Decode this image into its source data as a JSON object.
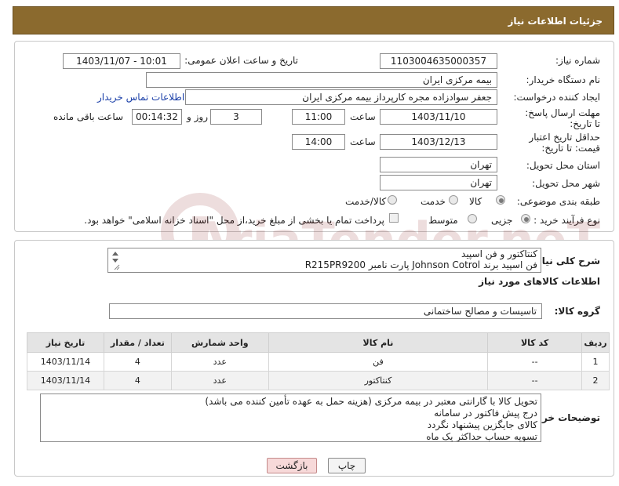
{
  "header": {
    "title": "جزئیات اطلاعات نیاز"
  },
  "form": {
    "need_number_label": "شماره نیاز:",
    "need_number": "1103004635000357",
    "announce_label": "تاریخ و ساعت اعلان عمومی:",
    "announce_value": "1403/11/07 - 10:01",
    "buyer_org_label": "نام دستگاه خریدار:",
    "buyer_org": "بیمه مرکزی ایران",
    "creator_label": "ایجاد کننده درخواست:",
    "creator": "جعفر سوادزاده مجره کارپرداز بیمه مرکزی ایران",
    "contact_link": "اطلاعات تماس خریدار",
    "deadline_label": "مهلت ارسال پاسخ: تا تاریخ:",
    "deadline_date": "1403/11/10",
    "time_label": "ساعت",
    "deadline_time": "11:00",
    "days_value": "3",
    "days_label": "روز و",
    "remaining_value": "00:14:32",
    "remaining_label": "ساعت باقی مانده",
    "validity_label": "حداقل تاریخ اعتبار قیمت: تا تاریخ:",
    "validity_date": "1403/12/13",
    "validity_time_label": "ساعت",
    "validity_time": "14:00",
    "province_label": "استان محل تحویل:",
    "province": "تهران",
    "city_label": "شهر محل تحویل:",
    "city": "تهران",
    "category_label": "طبقه بندی موضوعی:",
    "category_options": [
      "کالا",
      "خدمت",
      "کالا/خدمت"
    ],
    "process_label": "نوع فرآیند خرید :",
    "process_options": [
      "جزیی",
      "متوسط"
    ],
    "payment_note": "پرداخت تمام یا بخشی از مبلغ خرید،از محل \"اسناد خزانه اسلامی\" خواهد بود."
  },
  "summary": {
    "label": "شرح کلی نیاز:",
    "line1": "کنتاکتور و فن اسپید",
    "line2": "فن اسپید برند Johnson Cotrol پارت نامبر R215PR9200"
  },
  "goods": {
    "section_title": "اطلاعات کالاهای مورد نیاز",
    "group_label": "گروه کالا:",
    "group_value": "تاسیسات و مصالح ساختمانی",
    "table": {
      "headers": [
        "ردیف",
        "کد کالا",
        "نام کالا",
        "واحد شمارش",
        "تعداد / مقدار",
        "تاریخ نیاز"
      ],
      "rows": [
        [
          "1",
          "--",
          "فن",
          "عدد",
          "4",
          "1403/11/14"
        ],
        [
          "2",
          "--",
          "کنتاکتور",
          "عدد",
          "4",
          "1403/11/14"
        ]
      ]
    }
  },
  "buyer_notes": {
    "label": "توضیحات خریدار:",
    "lines": [
      "تحویل کالا با گارانتی معتبر در بیمه مرکزی (هزینه حمل به عهده تأمین کننده می باشد)",
      "درج پیش فاکتور در سامانه",
      "کالای جایگزین پیشنهاد نگردد",
      "تسویه حساب حداکثر یک ماه"
    ]
  },
  "buttons": {
    "print": "چاپ",
    "back": "بازگشت"
  },
  "watermark": {
    "text": "AriaTender.neT"
  },
  "colors": {
    "header": "#8b6a2e",
    "link": "#1a3fa8",
    "back_button": "#f7d9d9"
  }
}
